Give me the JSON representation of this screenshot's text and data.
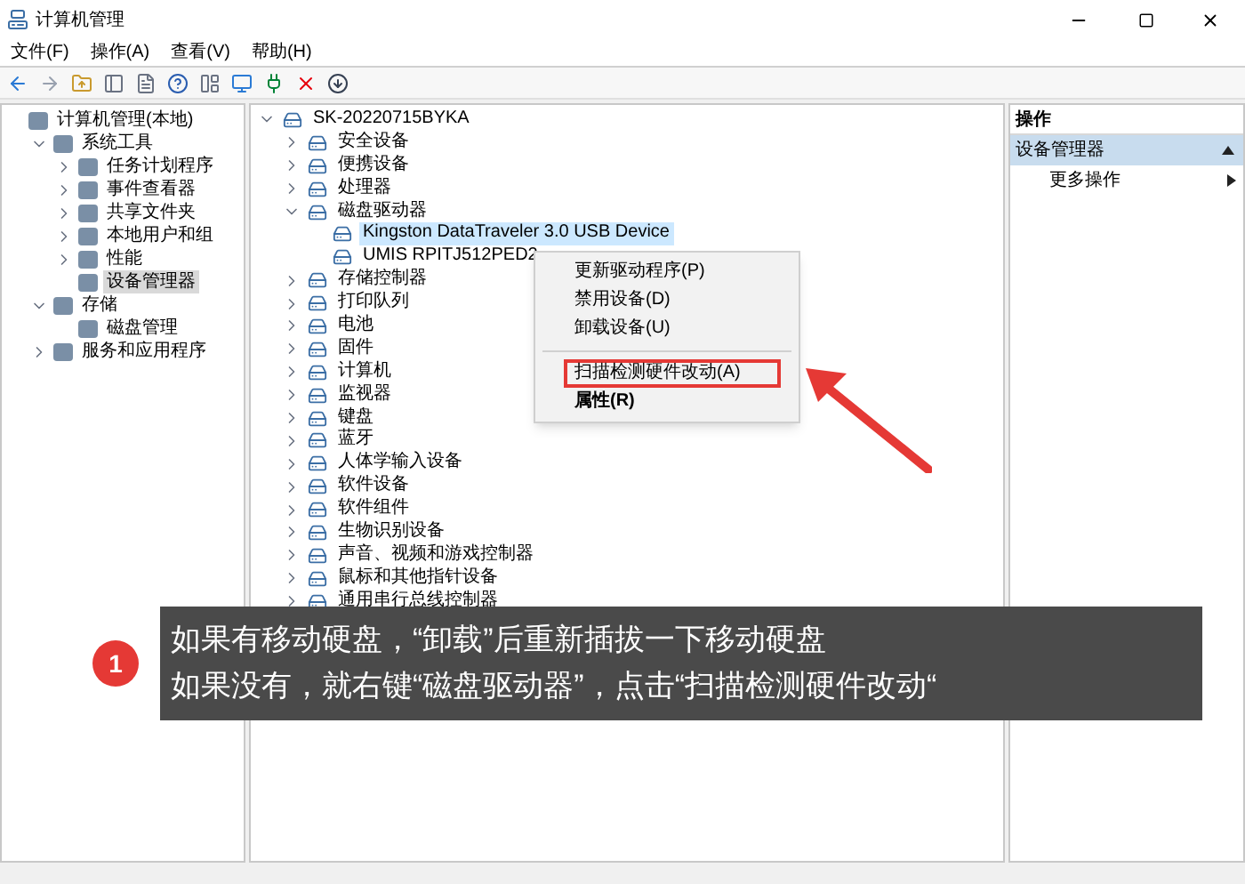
{
  "window": {
    "title": "计算机管理"
  },
  "menu": [
    "文件(F)",
    "操作(A)",
    "查看(V)",
    "帮助(H)"
  ],
  "left_tree": [
    {
      "label": "计算机管理(本地)",
      "selected": false,
      "children": [
        {
          "label": "系统工具",
          "expanded": true,
          "selected": false,
          "children": [
            {
              "label": "任务计划程序",
              "expanded": false,
              "selected": false
            },
            {
              "label": "事件查看器",
              "expanded": false,
              "selected": false
            },
            {
              "label": "共享文件夹",
              "expanded": false,
              "selected": false
            },
            {
              "label": "本地用户和组",
              "expanded": false,
              "selected": false
            },
            {
              "label": "性能",
              "expanded": false,
              "selected": false
            },
            {
              "label": "设备管理器",
              "selected": true
            }
          ]
        },
        {
          "label": "存储",
          "expanded": true,
          "selected": false,
          "children": [
            {
              "label": "磁盘管理",
              "selected": false
            }
          ]
        },
        {
          "label": "服务和应用程序",
          "expanded": false,
          "selected": false
        }
      ]
    }
  ],
  "device_tree": {
    "label": "SK-20220715BYKA",
    "expanded": true,
    "children": [
      {
        "label": "安全设备",
        "expanded": false,
        "selected": false
      },
      {
        "label": "便携设备",
        "expanded": false,
        "selected": false
      },
      {
        "label": "处理器",
        "expanded": false,
        "selected": false
      },
      {
        "label": "磁盘驱动器",
        "expanded": true,
        "selected": false,
        "children": [
          {
            "label": "Kingston DataTraveler 3.0 USB Device",
            "selected": true
          },
          {
            "label": "UMIS RPITJ512PED2",
            "selected": false
          }
        ]
      },
      {
        "label": "存储控制器",
        "expanded": false,
        "selected": false
      },
      {
        "label": "打印队列",
        "expanded": false,
        "selected": false
      },
      {
        "label": "电池",
        "expanded": false,
        "selected": false
      },
      {
        "label": "固件",
        "expanded": false,
        "selected": false
      },
      {
        "label": "计算机",
        "expanded": false,
        "selected": false
      },
      {
        "label": "监视器",
        "expanded": false,
        "selected": false
      },
      {
        "label": "键盘",
        "expanded": false,
        "selected": false
      },
      {
        "label": "蓝牙",
        "expanded": false,
        "selected": false
      },
      {
        "label": "人体学输入设备",
        "expanded": false,
        "selected": false
      },
      {
        "label": "软件设备",
        "expanded": false,
        "selected": false
      },
      {
        "label": "软件组件",
        "expanded": false,
        "selected": false
      },
      {
        "label": "生物识别设备",
        "expanded": false,
        "selected": false
      },
      {
        "label": "声音、视频和游戏控制器",
        "expanded": false,
        "selected": false
      },
      {
        "label": "鼠标和其他指针设备",
        "expanded": false,
        "selected": false
      },
      {
        "label": "通用串行总线控制器",
        "expanded": false,
        "selected": false
      }
    ]
  },
  "context_menu": [
    {
      "kind": "item",
      "label": "更新驱动程序(P)",
      "bold": false,
      "highlighted": false
    },
    {
      "kind": "item",
      "label": "禁用设备(D)",
      "bold": false,
      "highlighted": false
    },
    {
      "kind": "item",
      "label": "卸载设备(U)",
      "bold": false,
      "highlighted": false
    },
    {
      "kind": "separator"
    },
    {
      "kind": "item",
      "label": "扫描检测硬件改动(A)",
      "bold": false,
      "highlighted": true
    },
    {
      "kind": "item",
      "label": "属性(R)",
      "bold": true,
      "highlighted": false
    }
  ],
  "actions_pane": {
    "title": "操作",
    "section": "设备管理器",
    "items": [
      "更多操作"
    ]
  },
  "annotation": {
    "badge": "1",
    "lines": [
      "如果有移动硬盘，“卸载”后重新插拔一下移动硬盘",
      "如果没有，就右键“磁盘驱动器”，点击“扫描检测硬件改动“"
    ]
  }
}
